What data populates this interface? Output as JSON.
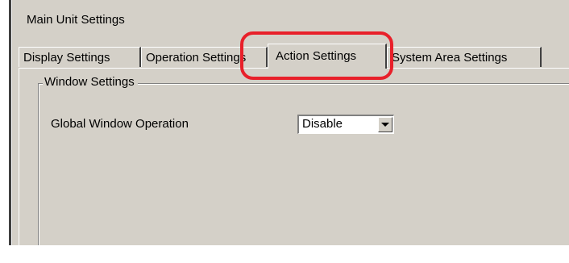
{
  "window": {
    "section_title": "Main Unit Settings"
  },
  "tabs": [
    {
      "label": "Display Settings",
      "active": false
    },
    {
      "label": "Operation Settings",
      "active": false
    },
    {
      "label": "Action Settings",
      "active": true
    },
    {
      "label": "System Area Settings",
      "active": false
    }
  ],
  "window_settings": {
    "group_label": "Window Settings",
    "global_window_operation": {
      "label": "Global Window Operation",
      "value": "Disable"
    }
  },
  "annotation": {
    "highlight_color": "#e8202a",
    "highlighted_tab": "Action Settings"
  },
  "colors": {
    "dialog_background": "#d4d0c8",
    "highlight": "#e8202a"
  },
  "icons": {
    "dropdown": "chevron-down-icon"
  }
}
